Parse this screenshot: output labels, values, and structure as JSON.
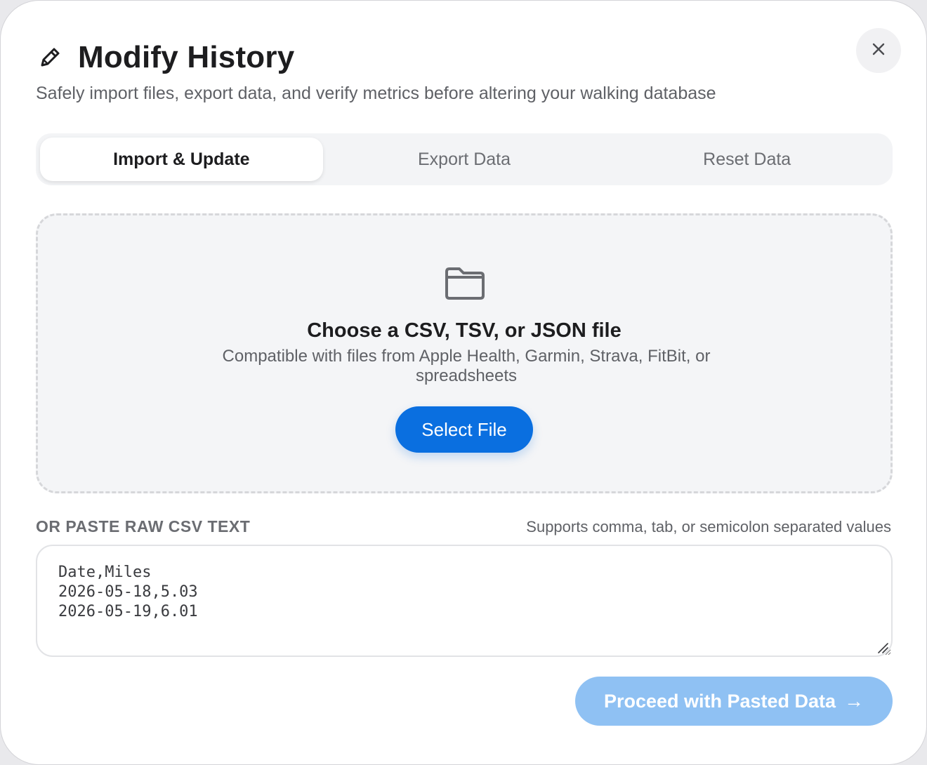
{
  "header": {
    "title": "Modify History",
    "subtitle": "Safely import files, export data, and verify metrics before altering your walking database",
    "title_icon": "pencil-icon",
    "close_icon": "close-icon"
  },
  "tabs": [
    {
      "label": "Import & Update",
      "active": true
    },
    {
      "label": "Export Data",
      "active": false
    },
    {
      "label": "Reset Data",
      "active": false
    }
  ],
  "dropzone": {
    "icon": "folder-icon",
    "title": "Choose a CSV, TSV, or JSON file",
    "subtitle": "Compatible with files from Apple Health, Garmin, Strava, FitBit, or spreadsheets",
    "button_label": "Select File"
  },
  "paste": {
    "label": "OR PASTE RAW CSV TEXT",
    "hint": "Supports comma, tab, or semicolon separated values",
    "value": "Date,Miles\n2026-05-18,5.03\n2026-05-19,6.01"
  },
  "proceed": {
    "label": "Proceed with Pasted Data",
    "arrow": "→"
  },
  "colors": {
    "accent": "#0a6fe0",
    "accent_disabled": "#8fc1f3"
  }
}
